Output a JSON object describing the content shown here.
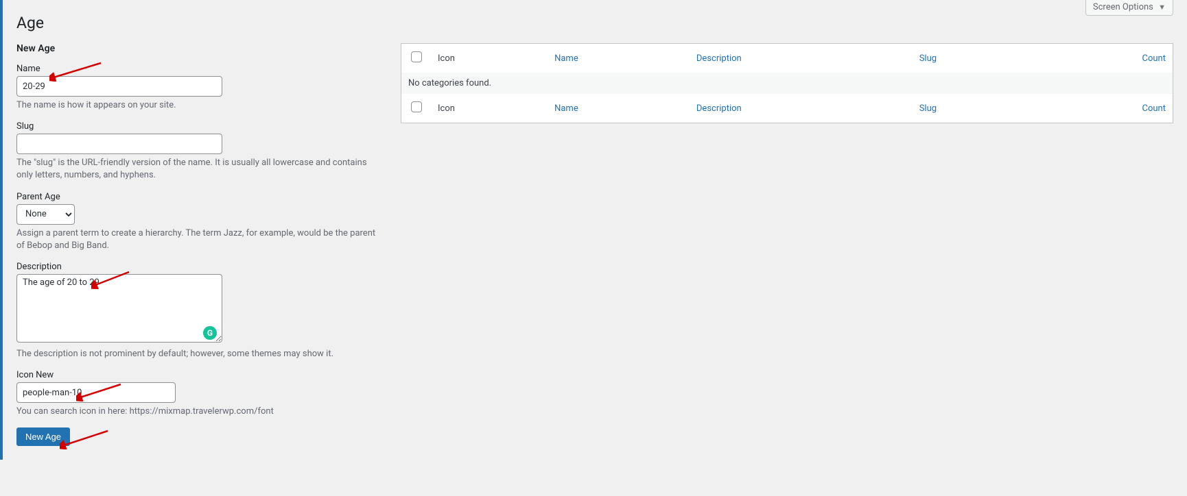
{
  "screen_options_label": "Screen Options",
  "page_title": "Age",
  "form_heading": "New Age",
  "fields": {
    "name": {
      "label": "Name",
      "value": "20-29",
      "help": "The name is how it appears on your site."
    },
    "slug": {
      "label": "Slug",
      "value": "",
      "help": "The \"slug\" is the URL-friendly version of the name. It is usually all lowercase and contains only letters, numbers, and hyphens."
    },
    "parent": {
      "label": "Parent Age",
      "selected": "None",
      "help": "Assign a parent term to create a hierarchy. The term Jazz, for example, would be the parent of Bebop and Big Band."
    },
    "description": {
      "label": "Description",
      "value": "The age of 20 to 29",
      "help": "The description is not prominent by default; however, some themes may show it."
    },
    "icon": {
      "label": "Icon New",
      "value": "people-man-10",
      "help": "You can search icon in here: https://mixmap.travelerwp.com/font"
    }
  },
  "submit_label": "New Age",
  "table": {
    "cols": {
      "icon": "Icon",
      "name": "Name",
      "description": "Description",
      "slug": "Slug",
      "count": "Count"
    },
    "empty": "No categories found."
  },
  "grammarly_glyph": "G"
}
